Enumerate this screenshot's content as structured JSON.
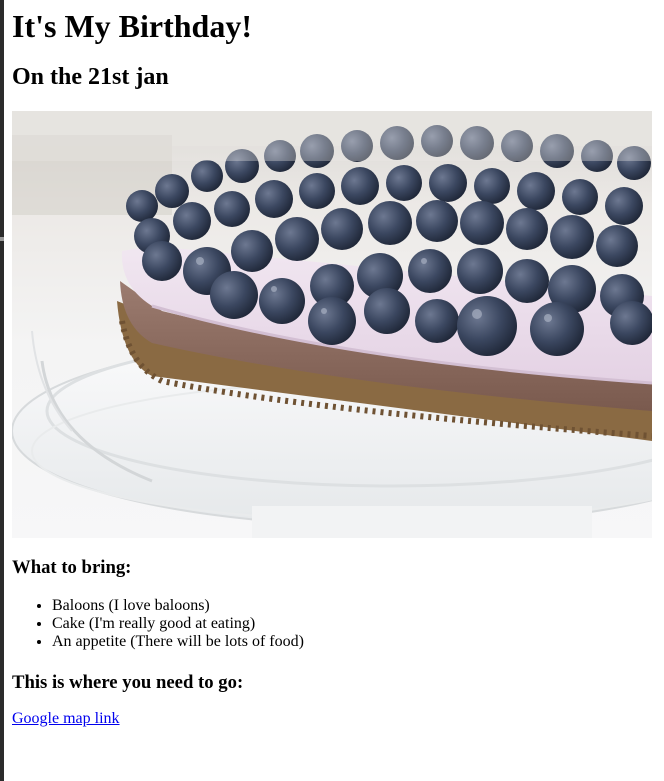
{
  "page": {
    "title": "It's My Birthday!",
    "subtitle": "On the 21st jan"
  },
  "image": {
    "icon_name": "cake-photo",
    "colors": {
      "background_top": "#e9e9e7",
      "stand": "#f3f4f5",
      "cream": "#ede0ec",
      "chocolate_layer": "#8a6a5c",
      "crust": "#8c6b45",
      "blueberry": "#3a4660"
    }
  },
  "bring_section": {
    "heading": "What to bring:",
    "items": [
      "Baloons (I love baloons)",
      "Cake (I'm really good at eating)",
      "An appetite (There will be lots of food)"
    ]
  },
  "go_section": {
    "heading": "This is where you need to go:",
    "link_text": "Google map link"
  },
  "colors": {
    "link": "#0000ee",
    "text": "#000000",
    "left_bar": "#2b2b2b"
  }
}
